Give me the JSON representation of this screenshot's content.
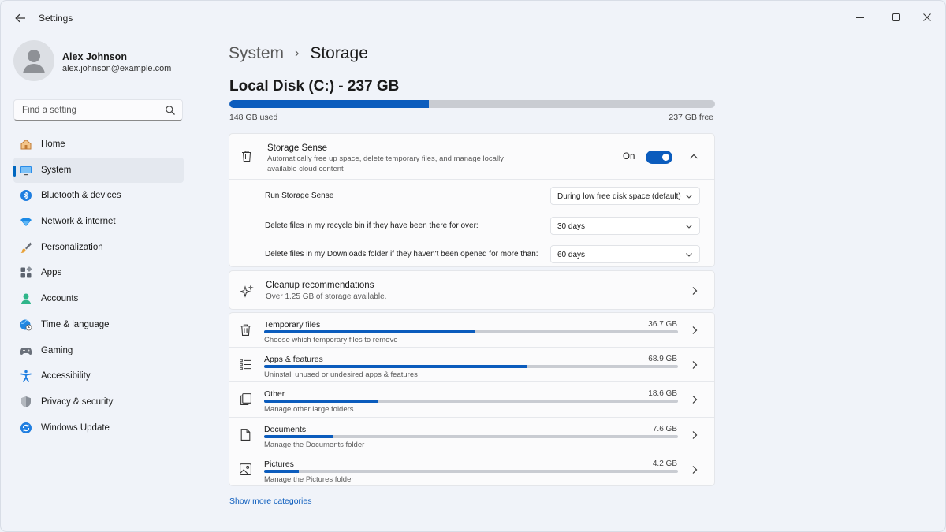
{
  "app": {
    "title": "Settings"
  },
  "profile": {
    "name": "Alex Johnson",
    "email": "alex.johnson@example.com"
  },
  "search": {
    "placeholder": "Find a setting"
  },
  "sidebar": {
    "items": [
      {
        "label": "Home",
        "icon": "home-icon"
      },
      {
        "label": "System",
        "icon": "system-icon",
        "active": true
      },
      {
        "label": "Bluetooth & devices",
        "icon": "bluetooth-icon"
      },
      {
        "label": "Network & internet",
        "icon": "network-icon"
      },
      {
        "label": "Personalization",
        "icon": "brush-icon"
      },
      {
        "label": "Apps",
        "icon": "apps-icon"
      },
      {
        "label": "Accounts",
        "icon": "accounts-icon"
      },
      {
        "label": "Time & language",
        "icon": "globe-clock-icon"
      },
      {
        "label": "Gaming",
        "icon": "gamepad-icon"
      },
      {
        "label": "Accessibility",
        "icon": "accessibility-icon"
      },
      {
        "label": "Privacy & security",
        "icon": "shield-icon"
      },
      {
        "label": "Windows Update",
        "icon": "update-icon"
      }
    ]
  },
  "breadcrumb": {
    "parent": "System",
    "separator": "›",
    "current": "Storage"
  },
  "disk": {
    "title": "Local Disk (C:) - 237 GB",
    "used_label": "148 GB used",
    "free_label": "237 GB free",
    "used_fraction": 0.411
  },
  "storage_sense": {
    "title": "Storage Sense",
    "description": "Automatically free up space, delete temporary files, and manage locally available cloud content",
    "toggle_label": "On",
    "enabled": true,
    "rows": [
      {
        "label": "Run Storage Sense",
        "value": "During low free disk space (default)"
      },
      {
        "label": "Delete files in my recycle bin if they have been there for over:",
        "value": "30 days"
      },
      {
        "label": "Delete files in my Downloads folder if they haven't been opened for more than:",
        "value": "60 days"
      }
    ]
  },
  "cleanup": {
    "title": "Cleanup recommendations",
    "description": "Over 1.25 GB of storage available."
  },
  "categories": [
    {
      "title": "Temporary files",
      "size": "36.7 GB",
      "description": "Choose which temporary files to remove",
      "fraction": 0.51,
      "icon": "trash-icon"
    },
    {
      "title": "Apps & features",
      "size": "68.9 GB",
      "description": "Uninstall unused or undesired apps & features",
      "fraction": 0.635,
      "icon": "list-icon"
    },
    {
      "title": "Other",
      "size": "18.6 GB",
      "description": "Manage other large folders",
      "fraction": 0.275,
      "icon": "copy-icon"
    },
    {
      "title": "Documents",
      "size": "7.6 GB",
      "description": "Manage the Documents folder",
      "fraction": 0.165,
      "icon": "document-icon"
    },
    {
      "title": "Pictures",
      "size": "4.2 GB",
      "description": "Manage the Pictures folder",
      "fraction": 0.083,
      "icon": "picture-icon"
    }
  ],
  "show_more": "Show more categories",
  "colors": {
    "accent": "#0b5cbd",
    "track": "#c9ccd2"
  }
}
